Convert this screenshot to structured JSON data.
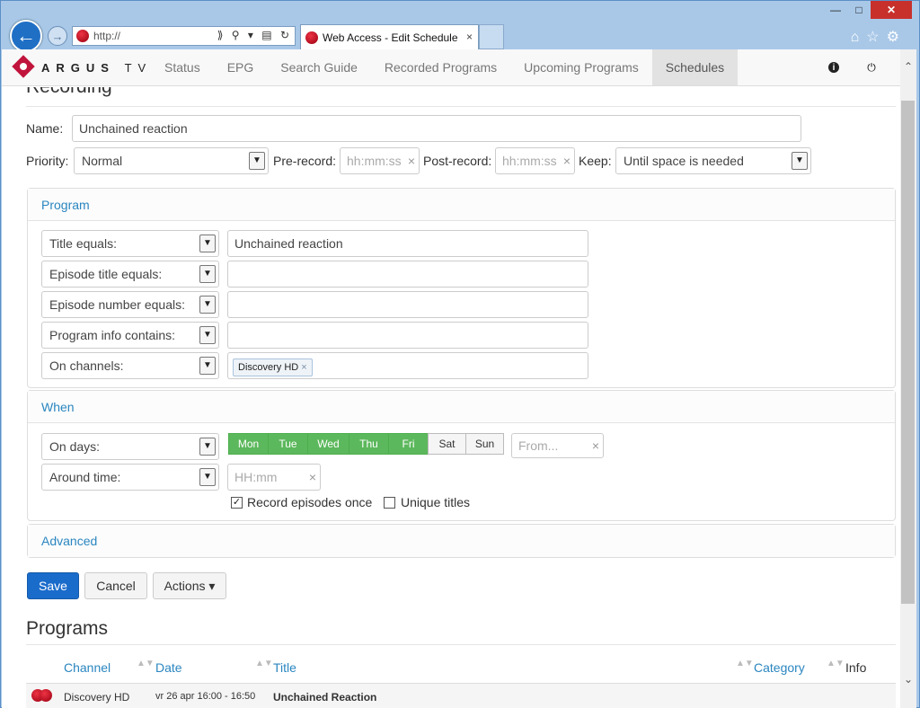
{
  "browser": {
    "address": "http://",
    "tab_title": "Web Access - Edit Schedule",
    "tab_close": "×",
    "caption": {
      "minimize": "—",
      "maximize": "□",
      "close": "✕"
    },
    "tools": "⌂☆⚙",
    "back": "←",
    "forward": "→",
    "address_icons": "⟫ ⚲ ▾ ▤ ↻"
  },
  "nav": {
    "brand": "ARGUS",
    "brand_tv": "TV",
    "items": [
      "Status",
      "EPG",
      "Search Guide",
      "Recorded Programs",
      "Upcoming Programs",
      "Schedules"
    ],
    "active": "Schedules"
  },
  "form": {
    "section_title": "Recording",
    "name_label": "Name:",
    "name_value": "Unchained reaction",
    "priority_label": "Priority:",
    "priority_value": "Normal",
    "prerecord_label": "Pre-record:",
    "prerecord_placeholder": "hh:mm:ss",
    "postrecord_label": "Post-record:",
    "postrecord_placeholder": "hh:mm:ss",
    "keep_label": "Keep:",
    "keep_value": "Until space is needed",
    "clear_x": "×",
    "dropdown_arrow": "▼"
  },
  "program_panel": {
    "title": "Program",
    "rules": [
      {
        "operator": "Title equals:",
        "value": "Unchained reaction"
      },
      {
        "operator": "Episode title equals:",
        "value": ""
      },
      {
        "operator": "Episode number equals:",
        "value": ""
      },
      {
        "operator": "Program info contains:",
        "value": ""
      },
      {
        "operator": "On channels:",
        "value": ""
      }
    ],
    "channel_chip": "Discovery HD",
    "chip_x": "×"
  },
  "when_panel": {
    "title": "When",
    "days_operator": "On days:",
    "days": [
      {
        "label": "Mon",
        "on": true
      },
      {
        "label": "Tue",
        "on": true
      },
      {
        "label": "Wed",
        "on": true
      },
      {
        "label": "Thu",
        "on": true
      },
      {
        "label": "Fri",
        "on": true
      },
      {
        "label": "Sat",
        "on": false
      },
      {
        "label": "Sun",
        "on": false
      }
    ],
    "from_placeholder": "From...",
    "time_operator": "Around time:",
    "time_placeholder": "HH:mm",
    "record_once_label": "Record episodes once",
    "record_once_checked": true,
    "unique_titles_label": "Unique titles",
    "unique_titles_checked": false,
    "check_mark": "✓"
  },
  "advanced_panel": {
    "title": "Advanced"
  },
  "buttons": {
    "save": "Save",
    "cancel": "Cancel",
    "actions": "Actions ▾"
  },
  "programs": {
    "title": "Programs",
    "columns": [
      "Channel",
      "Date",
      "Title",
      "Category",
      "Info"
    ],
    "sort_glyph": "▲▼",
    "rows": [
      {
        "channel": "Discovery HD",
        "date": "vr 26 apr 16:00 - 16:50",
        "title": "Unchained Reaction"
      }
    ]
  },
  "scrollbar": {
    "up": "⌃",
    "down": "⌄"
  },
  "colors": {
    "accent": "#2a86c0",
    "primary": "#1a6ccb",
    "day_on": "#5cb85c",
    "brand": "#c0143c"
  }
}
